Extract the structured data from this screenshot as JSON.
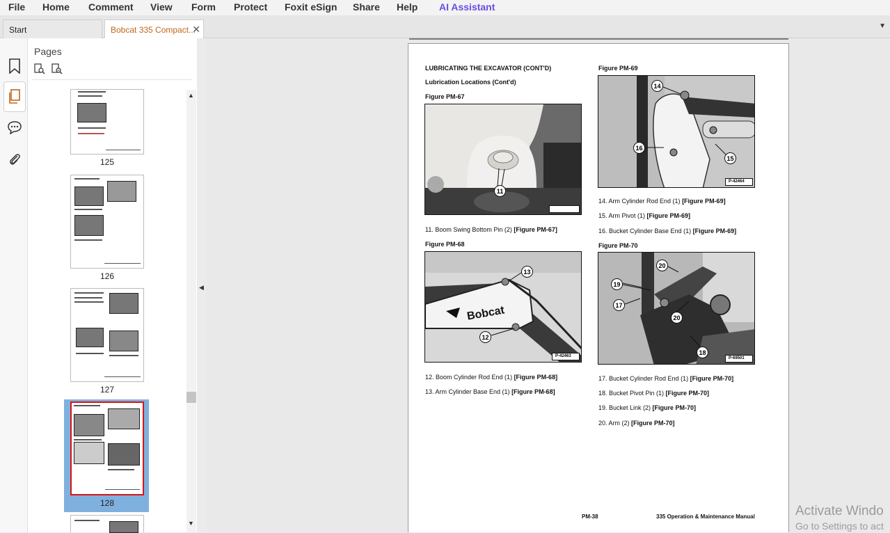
{
  "menu": {
    "file": "File",
    "home": "Home",
    "comment": "Comment",
    "view": "View",
    "form": "Form",
    "protect": "Protect",
    "esign": "Foxit eSign",
    "share": "Share",
    "help": "Help",
    "ai": "AI Assistant"
  },
  "tabs": {
    "start": "Start",
    "doc": "Bobcat 335 Compact..."
  },
  "pages_panel": {
    "title": "Pages",
    "thumbs": [
      {
        "label": "125"
      },
      {
        "label": "126"
      },
      {
        "label": "127"
      },
      {
        "label": "128"
      }
    ]
  },
  "page": {
    "heading": "LUBRICATING THE EXCAVATOR (CONT'D)",
    "subheading": "Lubrication Locations (Cont'd)",
    "fig67": {
      "title": "Figure PM-67",
      "callouts": [
        "11"
      ],
      "code": ""
    },
    "item11": {
      "text": "11. Boom Swing Bottom Pin (2) ",
      "ref": "[Figure PM-67]"
    },
    "fig68": {
      "title": "Figure PM-68",
      "callouts": [
        "13",
        "12"
      ],
      "code": "P-42463",
      "logo": "Bobcat"
    },
    "item12": {
      "text": "12. Boom Cylinder Rod End (1) ",
      "ref": "[Figure PM-68]"
    },
    "item13": {
      "text": "13. Arm Cylinder Base End (1) ",
      "ref": "[Figure PM-68]"
    },
    "fig69": {
      "title": "Figure PM-69",
      "callouts": [
        "14",
        "16",
        "15"
      ],
      "code": "P-42464"
    },
    "item14": {
      "text": "14. Arm Cylinder Rod End (1) ",
      "ref": "[Figure PM-69]"
    },
    "item15": {
      "text": "15. Arm Pivot (1) ",
      "ref": "[Figure PM-69]"
    },
    "item16": {
      "text": "16. Bucket Cylinder Base End (1) ",
      "ref": "[Figure PM-69]"
    },
    "fig70": {
      "title": "Figure PM-70",
      "callouts": [
        "20",
        "19",
        "17",
        "20",
        "18"
      ],
      "code": "P-69501"
    },
    "item17": {
      "text": "17. Bucket Cylinder Rod End (1) ",
      "ref": "[Figure PM-70]"
    },
    "item18": {
      "text": "18. Bucket Pivot Pin (1) ",
      "ref": "[Figure PM-70]"
    },
    "item19": {
      "text": "19. Bucket Link (2) ",
      "ref": "[Figure PM-70]"
    },
    "item20": {
      "text": "20. Arm (2) ",
      "ref": "[Figure PM-70]"
    },
    "footer_page": "PM-38",
    "footer_title": "335 Operation & Maintenance Manual"
  },
  "watermark": {
    "line1": "Activate Windo",
    "line2": "Go to Settings to act"
  },
  "colors": {
    "accent_tab": "#c0661a",
    "ai": "#6b4ce6",
    "selection": "#7fb0de",
    "selection_border": "#d11"
  }
}
